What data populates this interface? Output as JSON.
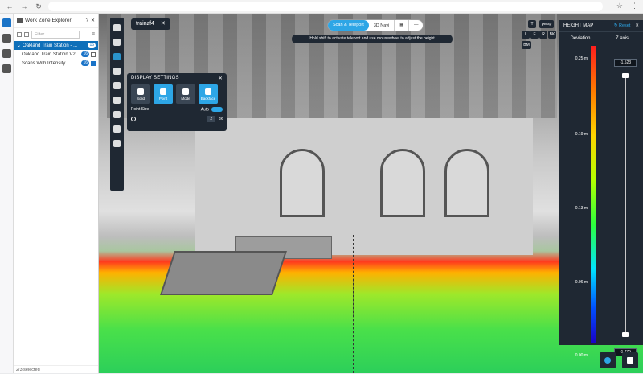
{
  "explorer": {
    "title": "Work Zone Explorer",
    "filter_placeholder": "Filter...",
    "items": [
      {
        "label": "Oakland Train Station - ...",
        "badge": "16",
        "selected": true
      },
      {
        "label": "Oakland Train Station V2 ...",
        "badge": "16",
        "selected": false
      },
      {
        "label": "Scans With Intensity",
        "badge": "16",
        "selected": false
      }
    ],
    "footer": "2/3 selected"
  },
  "viewport": {
    "tab_label": "trainzf4",
    "mode_scan": "Scan & Teleport",
    "mode_3d": "3D Navi",
    "hint": "Hold shift to activate teleport and use mousewheel to adjust the height",
    "view_letters": [
      "T",
      "L",
      "F",
      "R",
      "BK",
      "BM"
    ],
    "view_persp": "persp"
  },
  "display_settings": {
    "title": "DISPLAY SETTINGS",
    "buttons": [
      "Solid",
      "Point",
      "Mode",
      "Backface"
    ],
    "point_size_label": "Point Size",
    "auto_label": "Auto",
    "point_size_value": "2",
    "point_size_unit": "px"
  },
  "height_map": {
    "title": "HEIGHT MAP",
    "reset": "Reset",
    "deviation_label": "Deviation",
    "z_axis_label": "Z axis",
    "ticks": [
      "0.25 m",
      "0.19 m",
      "0.13 m",
      "0.06 m",
      "0.00 m"
    ],
    "z_top": "-1.523",
    "z_bottom": "-1.775"
  }
}
